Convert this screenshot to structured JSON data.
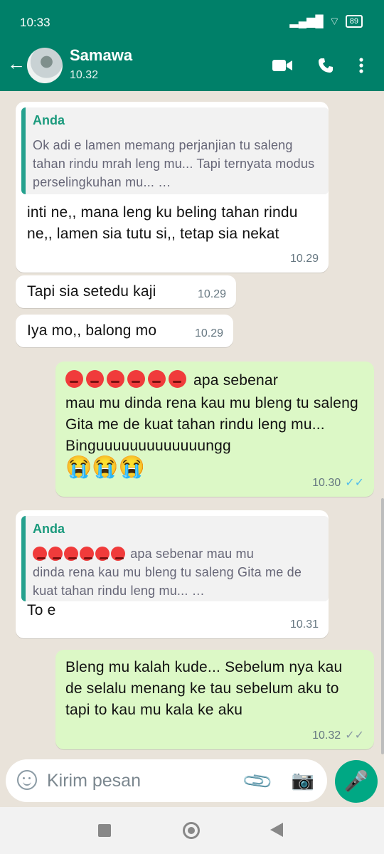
{
  "status": {
    "time": "10:33",
    "battery": "89"
  },
  "header": {
    "name": "Samawa",
    "last_seen": "10.32"
  },
  "messages": [
    {
      "quote_author": "Anda",
      "quote_text": "Ok adi e lamen memang perjanjian tu saleng tahan rindu mrah leng mu... Tapi ternyata modus perselingkuhan mu... …",
      "text": "inti ne,, mana leng ku beling tahan rindu ne,, lamen sia tutu si,, tetap sia nekat",
      "time": "10.29"
    },
    {
      "text": "Tapi sia setedu kaji",
      "time": "10.29"
    },
    {
      "text": "Iya mo,, balong mo",
      "time": "10.29"
    },
    {
      "text_line1": "apa sebenar",
      "text_lines": "mau mu dinda rena kau mu bleng tu saleng Gita me de kuat tahan rindu leng mu... Binguuuuuuuuuuuuungg",
      "time": "10.30"
    },
    {
      "quote_author": "Anda",
      "quote_text_line1": "apa sebenar mau mu",
      "quote_text_rest": "dinda rena kau mu bleng tu saleng Gita me de kuat tahan rindu leng mu... …",
      "text": "To e",
      "time": "10.31"
    },
    {
      "text": "Bleng mu kalah kude... Sebelum nya kau de selalu menang ke tau sebelum aku to tapi to kau mu kala ke aku",
      "time": "10.32"
    }
  ],
  "input": {
    "placeholder": "Kirim pesan"
  },
  "icons": {
    "back": "arrow-left-icon",
    "video": "video-call-icon",
    "call": "phone-icon",
    "menu": "more-vert-icon",
    "attach": "paperclip-icon",
    "camera": "camera-icon",
    "mic": "microphone-icon"
  },
  "colors": {
    "header": "#008069",
    "incoming": "#ffffff",
    "outgoing": "#dcf8c6",
    "accent": "#00a884",
    "quote_bar": "#25a18e"
  }
}
